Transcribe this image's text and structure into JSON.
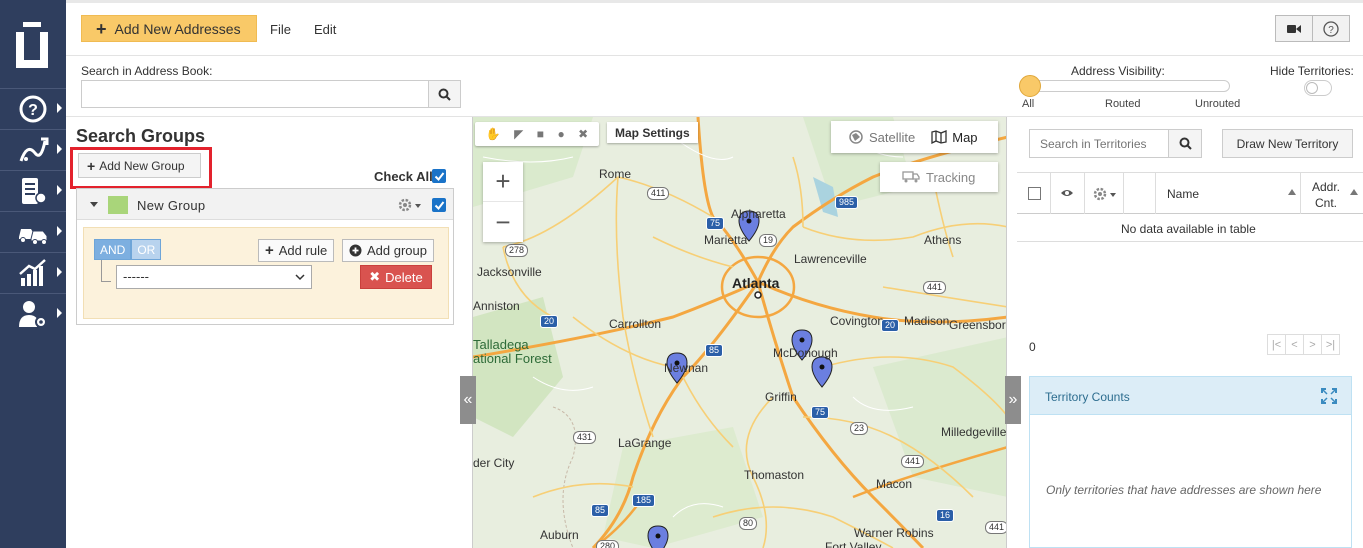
{
  "topbar": {
    "add_addresses_label": "Add New Addresses",
    "menu": [
      "File",
      "Edit"
    ],
    "video_icon": "video-icon",
    "help_icon": "help-icon"
  },
  "search": {
    "label": "Search in Address Book:",
    "value": "",
    "placeholder": ""
  },
  "visibility": {
    "label": "Address Visibility:",
    "ticks": [
      "All",
      "Routed",
      "Unrouted"
    ],
    "selected": "All"
  },
  "hide_territories": {
    "label": "Hide Territories:",
    "on": false
  },
  "search_groups": {
    "title": "Search Groups",
    "add_group_label": "Add New Group",
    "check_all_label": "Check All",
    "group": {
      "name": "New Group",
      "color": "#a9d57a",
      "and_label": "AND",
      "or_label": "OR",
      "add_rule_label": "Add rule",
      "add_group_label": "Add group",
      "rule_select_value": "------",
      "delete_label": "Delete"
    }
  },
  "map": {
    "settings_label": "Map Settings",
    "satellite_label": "Satellite",
    "map_label": "Map",
    "tracking_label": "Tracking",
    "zoom_in": "+",
    "zoom_out": "−",
    "places": {
      "rome": "Rome",
      "alpharetta": "Alpharetta",
      "marietta": "Marietta",
      "athens": "Athens",
      "lawrenceville": "Lawrenceville",
      "jacksonville": "Jacksonville",
      "atlanta": "Atlanta",
      "anniston": "Anniston",
      "carrollton": "Carrollton",
      "covington": "Covington",
      "madison": "Madison",
      "greensboro": "Greensboro",
      "talladega": "Talladega",
      "national_forest": "ational Forest",
      "mcdonough": "McDonough",
      "newnan": "Newnan",
      "griffin": "Griffin",
      "milledgeville": "Milledgeville",
      "lagrange": "LaGrange",
      "der_city": "der City",
      "thomaston": "Thomaston",
      "macon": "Macon",
      "auburn": "Auburn",
      "warner_robins": "Warner Robins",
      "fort_valley": "Fort Valley"
    },
    "routes": {
      "r411": "411",
      "r75a": "75",
      "r19": "19",
      "r985": "985",
      "r278": "278",
      "r441a": "441",
      "r20a": "20",
      "r20b": "20",
      "r85a": "85",
      "r75b": "75",
      "r23": "23",
      "r431": "431",
      "r441b": "441",
      "r185": "185",
      "r85b": "85",
      "r80": "80",
      "r280": "280",
      "r16": "16",
      "r441c": "441"
    }
  },
  "territories": {
    "search_placeholder": "Search in Territories",
    "draw_label": "Draw New Territory",
    "col_name": "Name",
    "col_addr_1": "Addr.",
    "col_addr_2": "Cnt.",
    "no_data": "No data available in table",
    "count": "0",
    "pager": [
      "|<",
      "<",
      ">",
      ">|"
    ],
    "counts_title": "Territory Counts",
    "counts_note": "Only territories that have addresses are shown here"
  },
  "colors": {
    "nav_bg": "#2f3e5e",
    "accent": "#f9c968",
    "highlight": "#e3222d",
    "checkbox": "#1a73c8",
    "delete": "#d9534f"
  }
}
